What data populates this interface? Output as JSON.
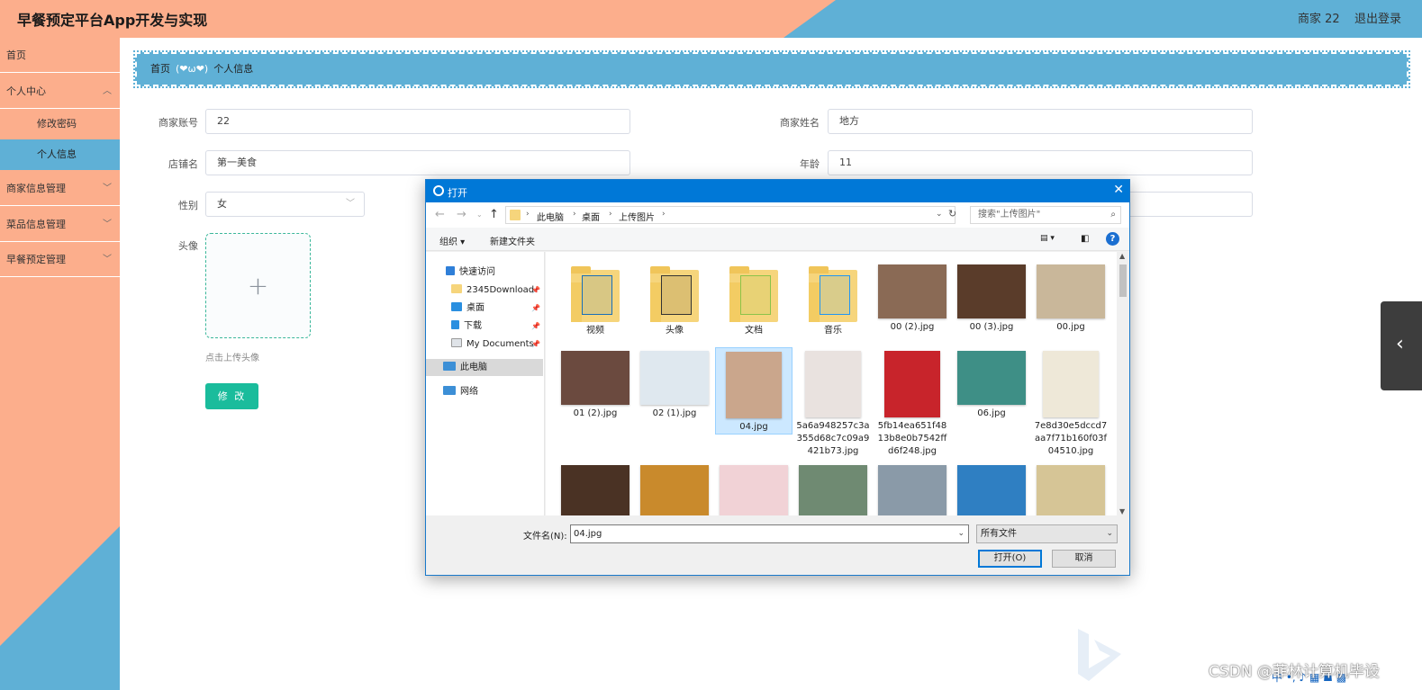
{
  "header": {
    "title": "早餐预定平台App开发与实现",
    "user": "商家 22",
    "logout": "退出登录",
    "colors": {
      "left": "#fcae8c",
      "right": "#5fb0d6"
    }
  },
  "sidebar": {
    "home": "首页",
    "personal_center": "个人中心",
    "change_password": "修改密码",
    "personal_info": "个人信息",
    "merchant_info": "商家信息管理",
    "dish_info": "菜品信息管理",
    "booking": "早餐预定管理",
    "chevron": "chevron-down-icon"
  },
  "breadcrumb": {
    "home": "首页",
    "separator": "(❤ω❤)",
    "current": "个人信息"
  },
  "form": {
    "account_label": "商家账号",
    "account_value": "22",
    "name_label": "商家姓名",
    "name_value": "地方",
    "shop_label": "店铺名",
    "shop_value": "第一美食",
    "age_label": "年龄",
    "age_value": "11",
    "gender_label": "性别",
    "gender_value": "女",
    "avatar_label": "头像",
    "upload_hint": "点击上传头像",
    "submit": "修 改"
  },
  "dialog": {
    "title": "打开",
    "path": [
      "此电脑",
      "桌面",
      "上传图片"
    ],
    "search_placeholder": "搜索\"上传图片\"",
    "organize": "组织 ▾",
    "new_folder": "新建文件夹",
    "help": "?",
    "tree": {
      "quick_access": "快速访问",
      "download_2345": "2345Download",
      "desktop": "桌面",
      "downloads": "下载",
      "my_documents": "My Documents",
      "this_pc": "此电脑",
      "network": "网络"
    },
    "files": [
      {
        "name": "视频",
        "kind": "folder",
        "color": "#1a6fb8"
      },
      {
        "name": "头像",
        "kind": "folder",
        "color": "#333333"
      },
      {
        "name": "文档",
        "kind": "folder",
        "color": "#8bc34a"
      },
      {
        "name": "音乐",
        "kind": "folder",
        "color": "#2196f3"
      },
      {
        "name": "00 (2).jpg",
        "kind": "image",
        "color": "#8a6a55"
      },
      {
        "name": "00 (3).jpg",
        "kind": "image",
        "color": "#5a3c2a"
      },
      {
        "name": "00.jpg",
        "kind": "image",
        "color": "#c9b79a"
      },
      {
        "name": "01 (2).jpg",
        "kind": "image",
        "color": "#6b4a3f"
      },
      {
        "name": "02 (1).jpg",
        "kind": "image",
        "color": "#dfe8ef"
      },
      {
        "name": "04.jpg",
        "kind": "image",
        "color": "#caa68c"
      },
      {
        "name": "5a6a948257c3a355d68c7c09a9421b73.jpg",
        "kind": "image",
        "color": "#e9e2df"
      },
      {
        "name": "5fb14ea651f4813b8e0b7542ffd6f248.jpg",
        "kind": "image",
        "color": "#c8242b"
      },
      {
        "name": "06.jpg",
        "kind": "image",
        "color": "#3e8f86"
      },
      {
        "name": "7e8d30e5dccd7aa7f71b160f03f04510.jpg",
        "kind": "image",
        "color": "#eee8d8"
      },
      {
        "name": "",
        "kind": "image",
        "color": "#4a3224"
      },
      {
        "name": "",
        "kind": "image",
        "color": "#c98a2c"
      },
      {
        "name": "",
        "kind": "image",
        "color": "#f1d2d6"
      },
      {
        "name": "",
        "kind": "image",
        "color": "#6f8a72"
      },
      {
        "name": "",
        "kind": "image",
        "color": "#8a9aa8"
      },
      {
        "name": "",
        "kind": "image",
        "color": "#2f7fc2"
      },
      {
        "name": "",
        "kind": "image",
        "color": "#d6c596"
      }
    ],
    "filename_label": "文件名(N):",
    "filename_value": "04.jpg",
    "filetype": "所有文件",
    "open": "打开(O)",
    "cancel": "取消"
  },
  "watermark": "CSDN @菲林计算机毕设",
  "tray": "中 •, ♪ ▦ ☗ ▩"
}
